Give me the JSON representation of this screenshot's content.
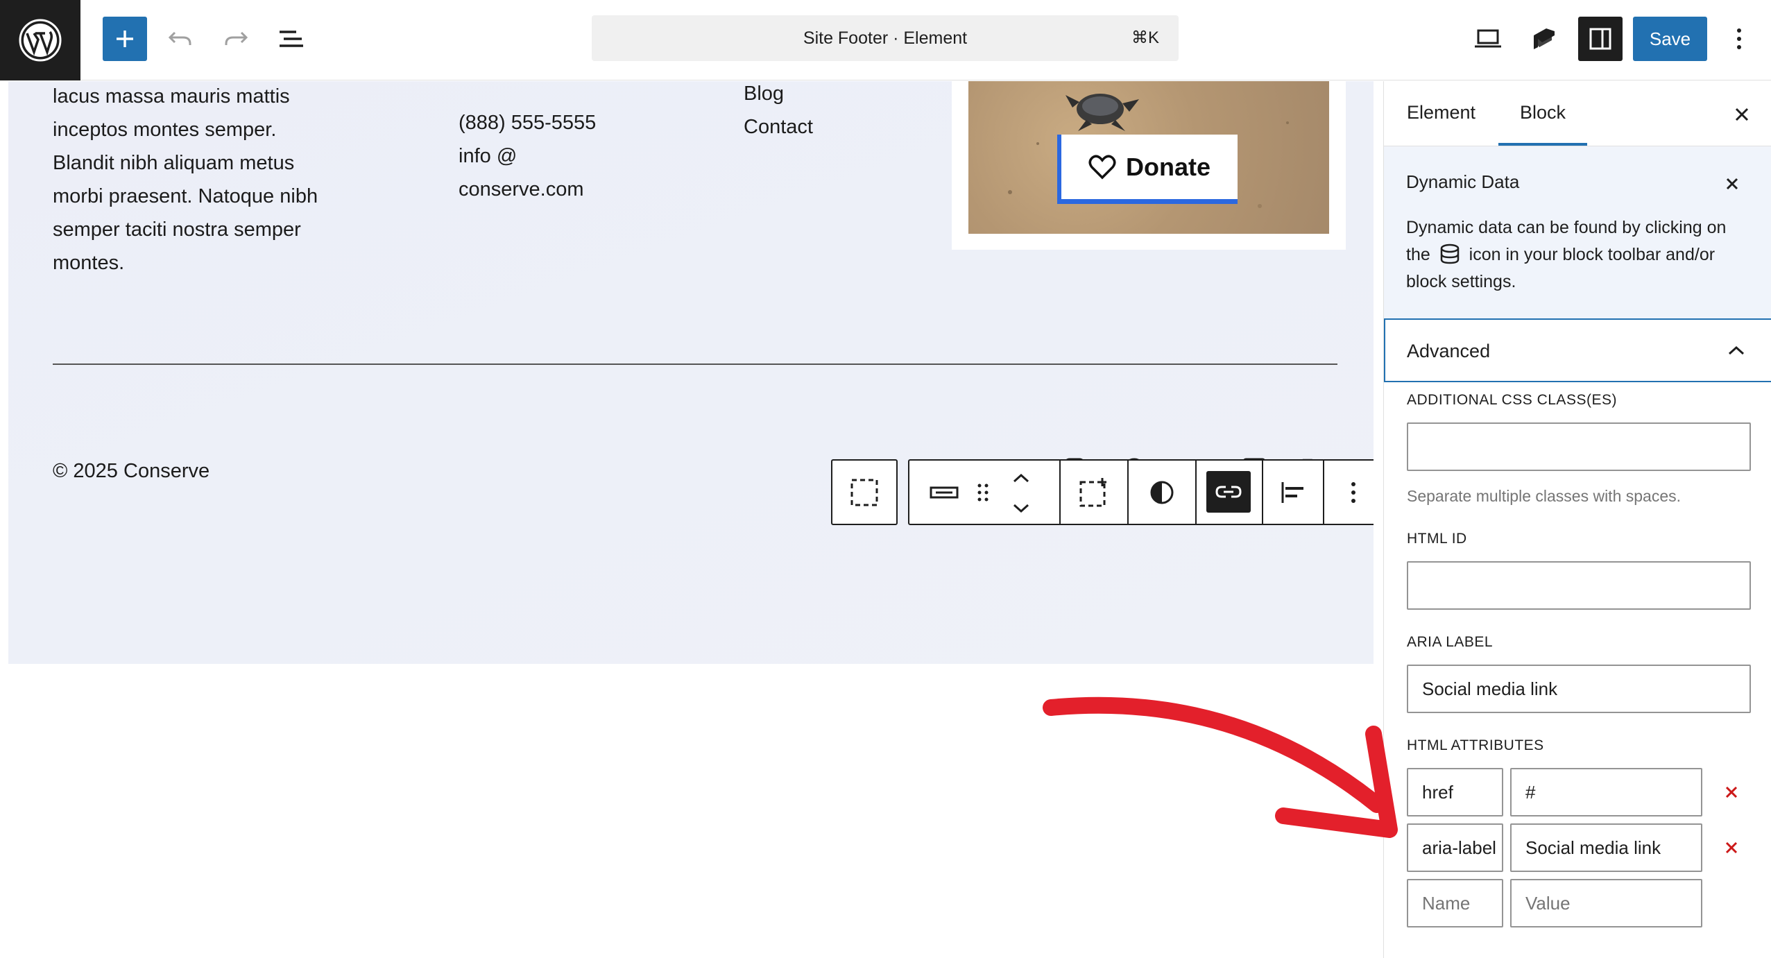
{
  "topbar": {
    "command_title": "Site Footer · Element",
    "command_shortcut": "⌘K",
    "save_label": "Save"
  },
  "footer": {
    "about_lines": [
      "lacus massa mauris mattis",
      "inceptos montes semper.",
      "Blandit nibh aliquam metus",
      "morbi praesent. Natoque nibh",
      "semper taciti nostra semper",
      "montes."
    ],
    "phone": "(888) 555-5555",
    "email_line1": "info @",
    "email_line2": "conserve.com",
    "nav_links": [
      "Blog",
      "Contact"
    ],
    "donate_label": "Donate",
    "copyright": "© 2025 Conserve",
    "social_icons": [
      "instagram-icon",
      "facebook-icon",
      "tiktok-icon",
      "linkedin-icon",
      "x-icon"
    ]
  },
  "sidebar": {
    "tabs": [
      {
        "label": "Element"
      },
      {
        "label": "Block"
      }
    ],
    "active_tab": "Block",
    "dynamic_data": {
      "title": "Dynamic Data",
      "text_before": "Dynamic data can be found by clicking on the",
      "text_after": "icon in your block toolbar and/or block settings."
    },
    "advanced": {
      "title": "Advanced",
      "css_label": "ADDITIONAL CSS CLASS(ES)",
      "css_value": "",
      "css_help": "Separate multiple classes with spaces.",
      "html_id_label": "HTML ID",
      "html_id_value": "",
      "aria_label_label": "ARIA LABEL",
      "aria_label_value": "Social media link",
      "html_attributes_label": "HTML ATTRIBUTES",
      "attributes": [
        {
          "name": "href",
          "value": "#"
        },
        {
          "name": "aria-label",
          "value": "Social media link"
        }
      ],
      "new_name_placeholder": "Name",
      "new_value_placeholder": "Value"
    }
  },
  "colors": {
    "accent": "#2271b1",
    "dark": "#1e1e1e",
    "annotation_arrow": "#e3202b",
    "remove": "#cc1818"
  }
}
